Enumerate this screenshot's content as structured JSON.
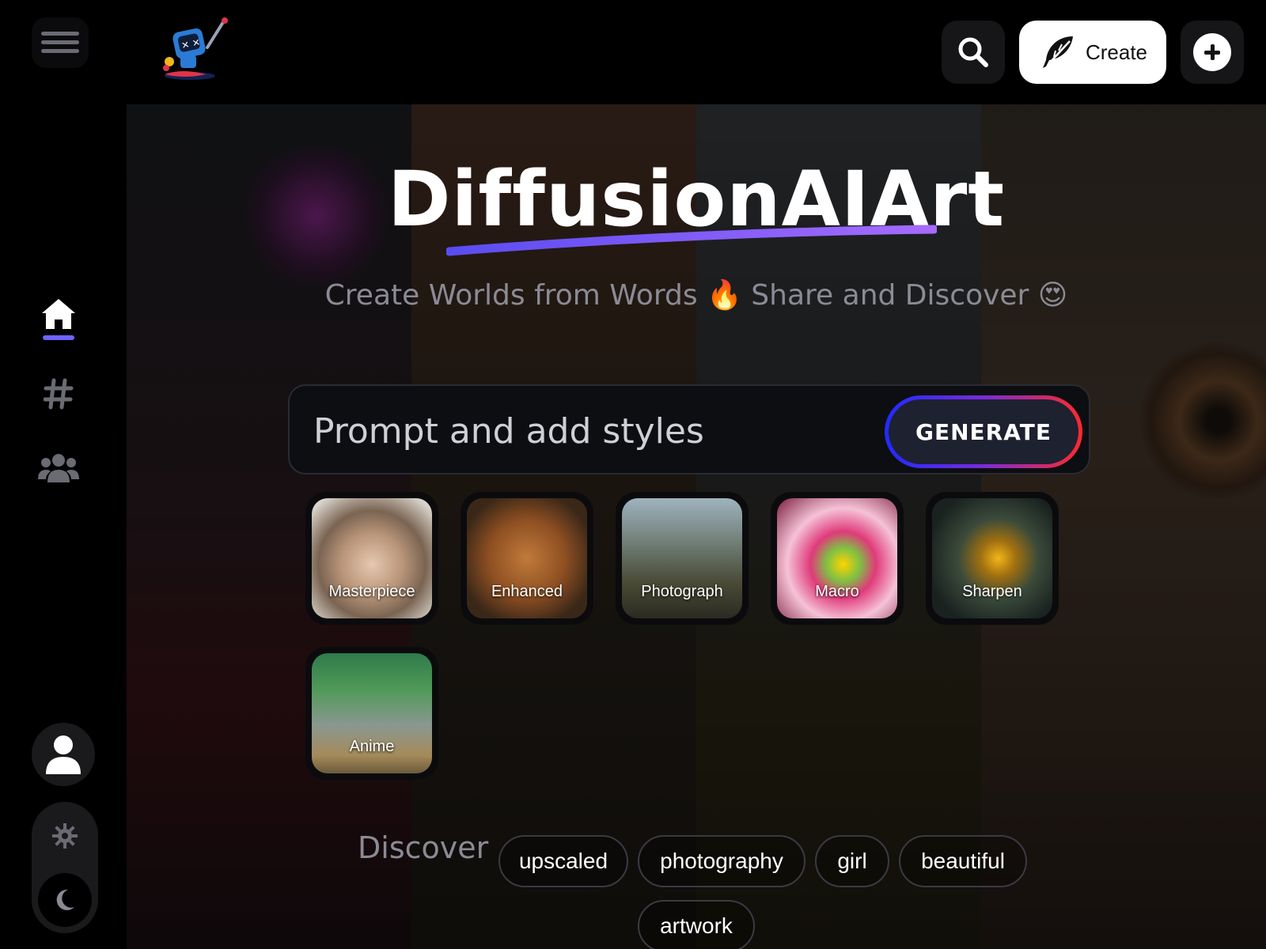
{
  "brand": {
    "name": "DiffusionAIArt"
  },
  "header": {
    "create_label": "Create"
  },
  "hero": {
    "title": "DiffusionAIArt",
    "subtitle": "Create Worlds from Words 🔥 Share and Discover 😍"
  },
  "prompt": {
    "placeholder": "Prompt and add styles",
    "generate_label": "GENERATE"
  },
  "styles": [
    {
      "label": "Masterpiece"
    },
    {
      "label": "Enhanced"
    },
    {
      "label": "Photograph"
    },
    {
      "label": "Macro"
    },
    {
      "label": "Sharpen"
    },
    {
      "label": "Anime"
    }
  ],
  "discover": {
    "label": "Discover",
    "tags": [
      "upscaled",
      "photography",
      "girl",
      "beautiful",
      "artwork"
    ]
  },
  "colors": {
    "accent": "#6d63ff",
    "generate_gradient": [
      "#1f2bff",
      "#7a2bd8",
      "#ff2a2a"
    ],
    "title_underline": [
      "#5a4cf0",
      "#a66bff"
    ]
  },
  "icons": {
    "menu": "hamburger-icon",
    "home": "home-icon",
    "tags": "hashtag-icon",
    "community": "users-icon",
    "profile": "user-icon",
    "theme_light": "gear-sun-icon",
    "theme_dark": "moon-icon",
    "search": "search-icon",
    "create": "feather-icon",
    "add": "plus-icon"
  }
}
